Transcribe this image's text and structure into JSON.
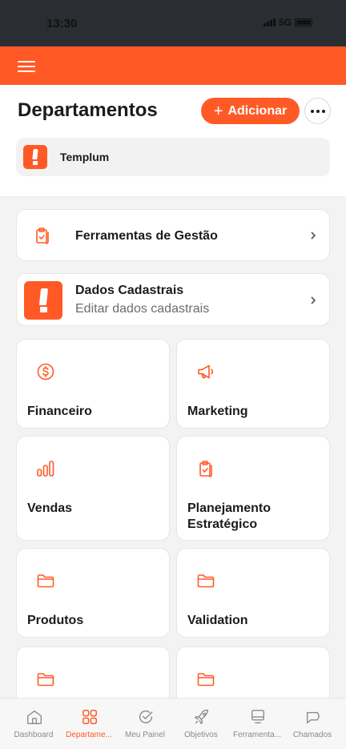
{
  "status_bar": {
    "time": "13:30",
    "network": "5G"
  },
  "header": {
    "title": "Departamentos",
    "add_label": "Adicionar",
    "company_name": "Templum"
  },
  "rows": [
    {
      "title": "Ferramentas de Gestão",
      "icon": "clipboard-check-icon"
    },
    {
      "title": "Dados Cadastrais",
      "subtitle": "Editar dados cadastrais",
      "icon": "templum-logo"
    }
  ],
  "departments": [
    {
      "label": "Financeiro",
      "icon": "dollar-circle-icon"
    },
    {
      "label": "Marketing",
      "icon": "megaphone-icon"
    },
    {
      "label": "Vendas",
      "icon": "bar-chart-icon"
    },
    {
      "label": "Planejamento Estratégico",
      "icon": "clipboard-check-icon"
    },
    {
      "label": "Produtos",
      "icon": "folder-icon"
    },
    {
      "label": "Validation",
      "icon": "folder-icon"
    },
    {
      "label": "",
      "icon": "folder-icon"
    },
    {
      "label": "",
      "icon": "folder-icon"
    }
  ],
  "nav": [
    {
      "label": "Dashboard",
      "icon": "home-icon",
      "active": false
    },
    {
      "label": "Departame...",
      "icon": "grid-icon",
      "active": true
    },
    {
      "label": "Meu Painel",
      "icon": "check-circle-icon",
      "active": false
    },
    {
      "label": "Objetivos",
      "icon": "rocket-icon",
      "active": false
    },
    {
      "label": "Ferramenta...",
      "icon": "monitor-icon",
      "active": false
    },
    {
      "label": "Chamados",
      "icon": "chat-icon",
      "active": false
    }
  ],
  "colors": {
    "accent": "#ff5a26",
    "status_bar": "#2a2d31",
    "background": "#f3f3f4",
    "nav_inactive": "#8a8a90"
  }
}
